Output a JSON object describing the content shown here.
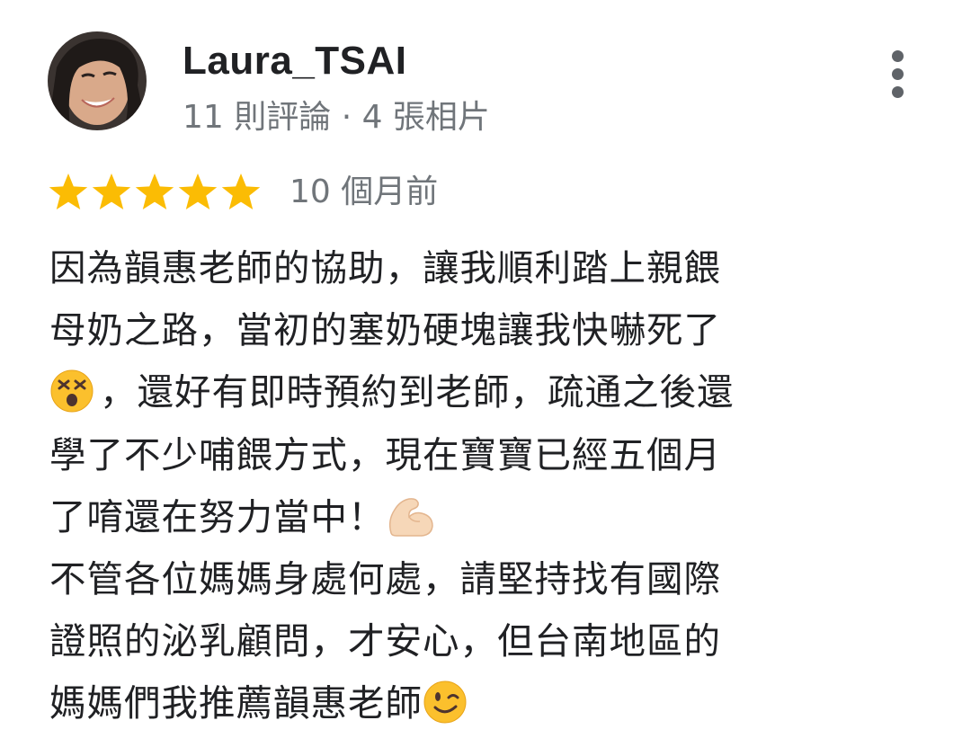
{
  "review": {
    "author": {
      "name": "Laura_TSAI",
      "meta": "11 則評論 · 4 張相片",
      "avatar_icon": "profile-photo"
    },
    "menu_icon": "more-vert-icon",
    "rating": {
      "stars": 5,
      "max_stars": 5,
      "star_color": "#fbbc04"
    },
    "time": "10 個月前",
    "body": {
      "line1": "因為韻惠老師的協助，讓我順利踏上親餵",
      "line2": "母奶之路，當初的塞奶硬塊讓我快嚇死了",
      "line3_emoji": "😵",
      "line3_text": "，還好有即時預約到老師，疏通之後還",
      "line4": "學了不少哺餵方式，現在寶寶已經五個月",
      "line5_text": "了唷還在努力當中！",
      "line5_emoji": "💪🏻",
      "line6": "不管各位媽媽身處何處，請堅持找有國際",
      "line7": "證照的泌乳顧問，才安心，但台南地區的",
      "line8_text": "媽媽們我推薦韻惠老師",
      "line8_emoji": "😉"
    }
  }
}
